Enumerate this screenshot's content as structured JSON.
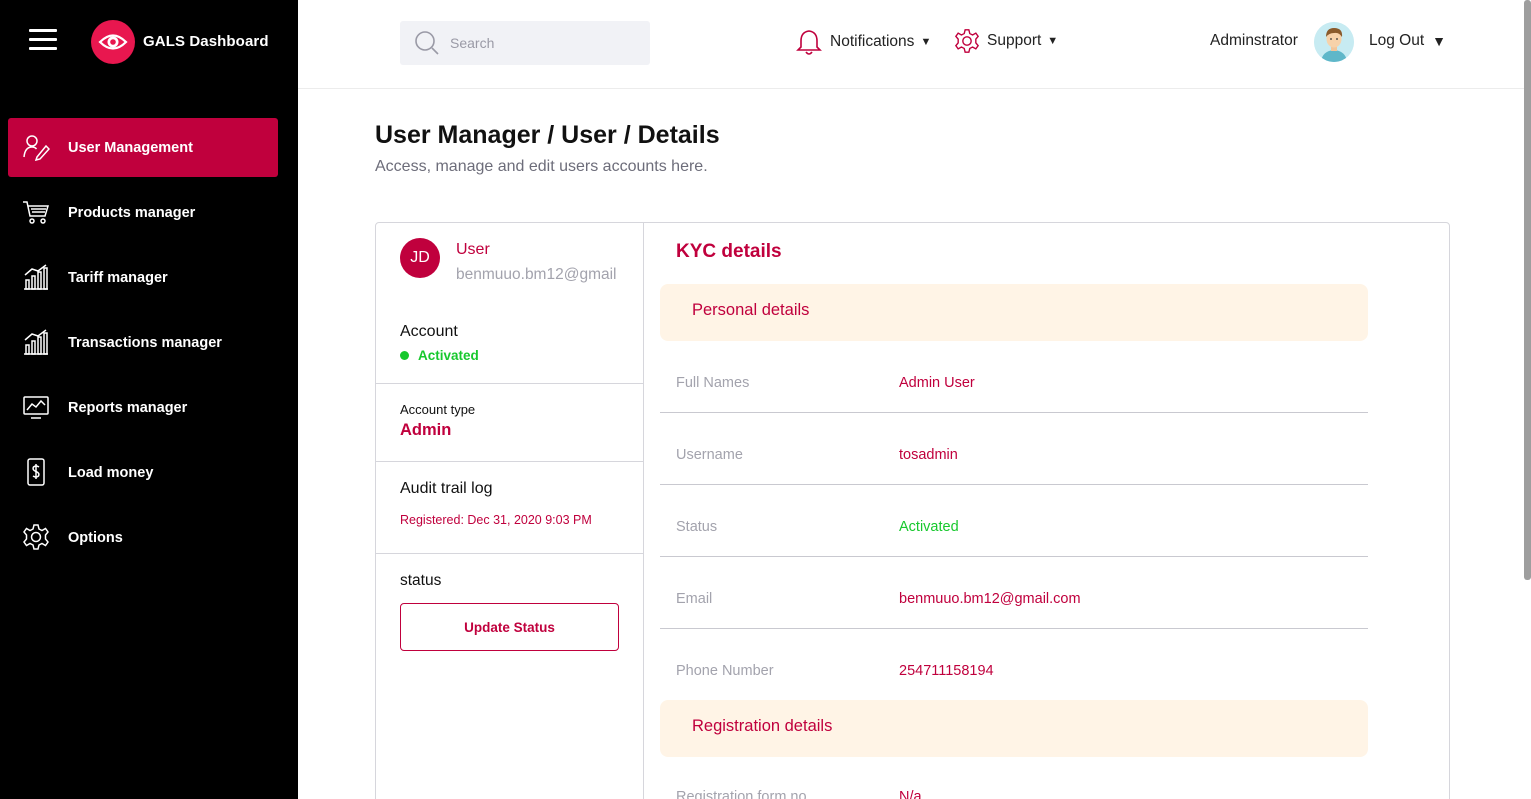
{
  "sidebar": {
    "brand": "GALS Dashboard",
    "items": [
      {
        "label": "User Management",
        "icon": "user-edit-icon",
        "active": true
      },
      {
        "label": "Products manager",
        "icon": "cart-icon"
      },
      {
        "label": "Tariff manager",
        "icon": "bar-chart-icon"
      },
      {
        "label": "Transactions manager",
        "icon": "bar-chart-icon"
      },
      {
        "label": "Reports manager",
        "icon": "report-icon"
      },
      {
        "label": "Load money",
        "icon": "money-icon"
      },
      {
        "label": "Options",
        "icon": "gear-icon"
      }
    ]
  },
  "topbar": {
    "search_placeholder": "Search",
    "notifications": "Notifications",
    "support": "Support",
    "admin_name": "Adminstrator",
    "logout": "Log Out"
  },
  "page": {
    "title": "User Manager / User / Details",
    "subtitle": "Access, manage and edit users accounts here."
  },
  "user_card": {
    "initials": "JD",
    "name": "User",
    "email": "benmuuo.bm12@gmail",
    "account_label": "Account",
    "account_status": "Activated",
    "type_label": "Account type",
    "type_value": "Admin",
    "audit_label": "Audit trail log",
    "audit_value": "Registered: Dec 31, 2020 9:03 PM",
    "status_label": "status",
    "update_button": "Update Status"
  },
  "kyc": {
    "title": "KYC details",
    "personal_header": "Personal details",
    "fields": [
      {
        "key": "Full Names",
        "value": "Admin User"
      },
      {
        "key": "Username",
        "value": "tosadmin"
      },
      {
        "key": "Status",
        "value": "Activated"
      },
      {
        "key": "Email",
        "value": "benmuuo.bm12@gmail.com"
      },
      {
        "key": "Phone Number",
        "value": "254711158194"
      }
    ],
    "registration_header": "Registration details",
    "registration_fields": [
      {
        "key": "Registration form no",
        "value": "N/a"
      }
    ]
  },
  "colors": {
    "accent": "#c0003d",
    "brand_logo": "#e8174f",
    "success": "#17c82d",
    "section_bg": "#fff4e6"
  }
}
